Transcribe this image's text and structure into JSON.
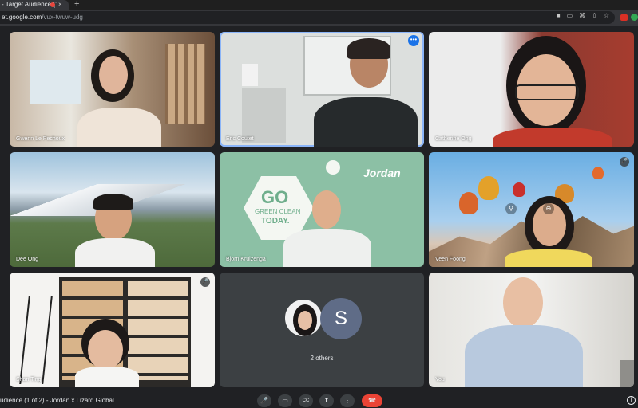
{
  "browser": {
    "tab_title": "- Target Audience (1",
    "tab_close": "×",
    "new_tab": "+",
    "url_host": "et.google.com",
    "url_path": "/vux-twuw-udg"
  },
  "participants": [
    {
      "name": "Gwenn Le Pechoux"
    },
    {
      "name": "Eric Coutet"
    },
    {
      "name": "Catherine Ong"
    },
    {
      "name": "Dee Ong"
    },
    {
      "name": "Bjorn Kruizenga"
    },
    {
      "name": "Veen Foong"
    },
    {
      "name": "Shan Ting"
    },
    {
      "name": "You"
    }
  ],
  "others": {
    "avatar_letter": "S",
    "label": "2 others"
  },
  "jordan_tile": {
    "brand": "Jordan",
    "go": "GO",
    "green_clean": "GREEN CLEAN",
    "today": "TODAY."
  },
  "bottom": {
    "meeting_title": "udience (1 of 2) - Jordan x Lizard Global",
    "mic_icon": "🎤",
    "cam_icon": "▭",
    "cc_icon": "CC",
    "present_icon": "⬆",
    "more_icon": "⋮",
    "hangup_icon": "☎",
    "info_icon": "i"
  },
  "colors": {
    "meet_bg": "#202124",
    "active_border": "#8ab4f8",
    "hangup": "#ea4335",
    "jordan_green": "#8cc0a5"
  }
}
